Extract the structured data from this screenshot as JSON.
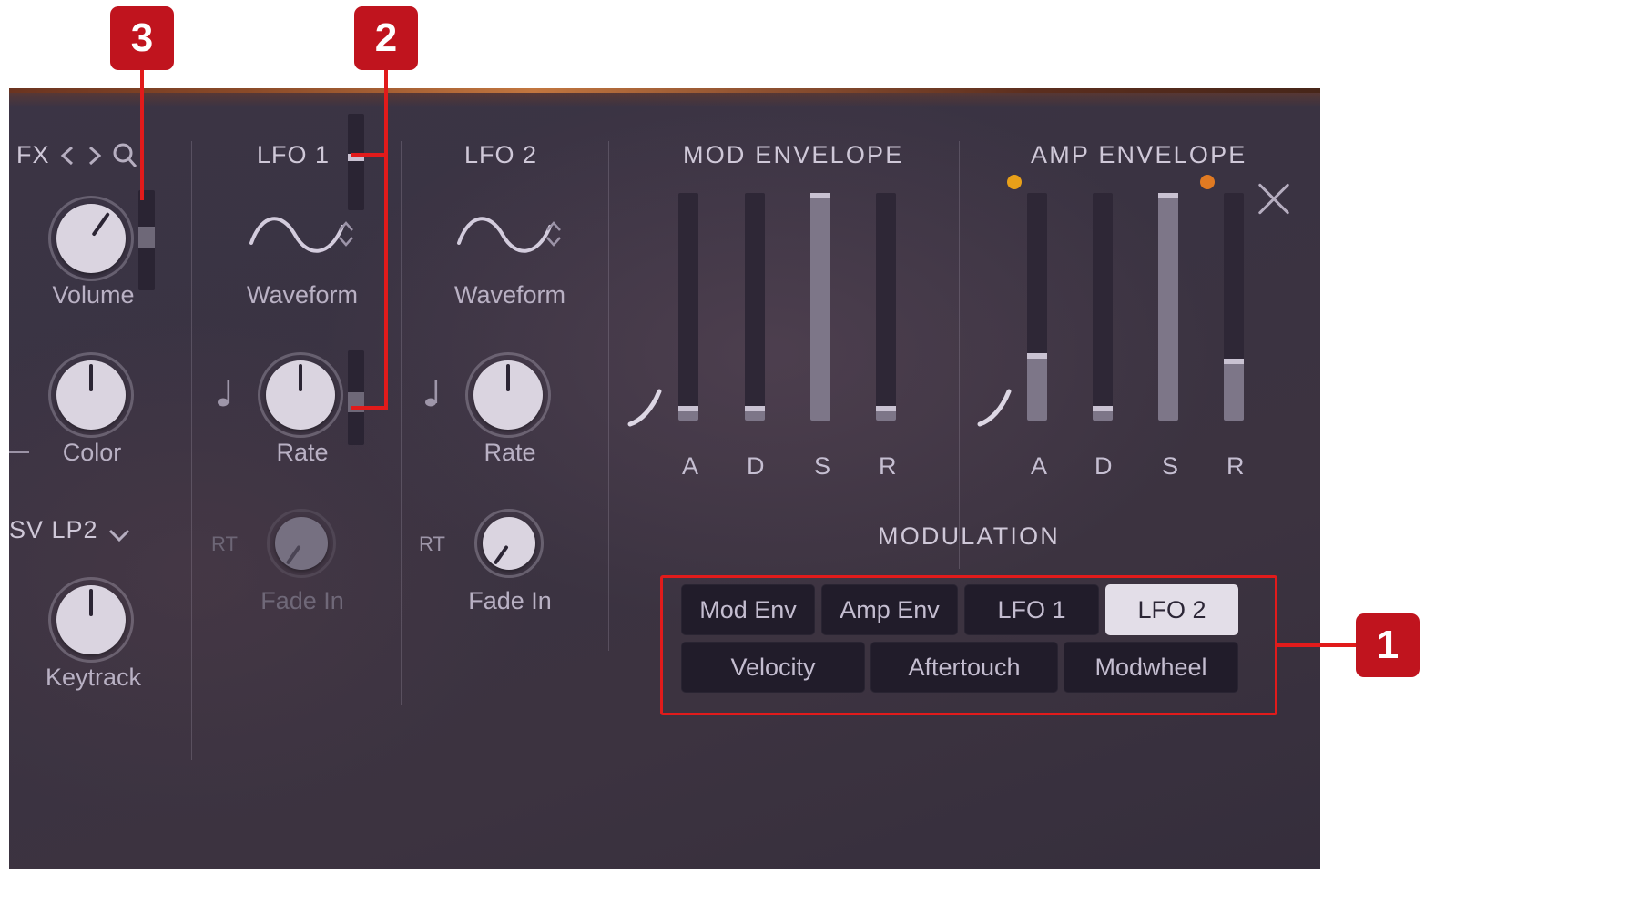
{
  "window": {
    "close_icon": "close-icon"
  },
  "left_panel": {
    "fx_label": "FX",
    "prev_icon": "chevron-left-icon",
    "next_icon": "chevron-right-icon",
    "search_icon": "search-icon",
    "volume_label": "Volume",
    "color_label": "Color",
    "filter_value": "SV LP2",
    "filter_chevron_icon": "chevron-down-icon",
    "keytrack_label": "Keytrack"
  },
  "lfo1": {
    "title": "LFO 1",
    "waveform_label": "Waveform",
    "waveform_icon": "sine-wave-icon",
    "waveform_stepper_icon": "stepper-updown-icon",
    "rate_label": "Rate",
    "rate_note_icon": "note-icon",
    "fade_in_label": "Fade In",
    "retrigger_label": "RT",
    "enabled": false
  },
  "lfo2": {
    "title": "LFO 2",
    "waveform_label": "Waveform",
    "waveform_icon": "sine-wave-icon",
    "waveform_stepper_icon": "stepper-updown-icon",
    "rate_label": "Rate",
    "rate_note_icon": "note-icon",
    "fade_in_label": "Fade In",
    "retrigger_label": "RT",
    "enabled": true
  },
  "mod_envelope": {
    "title": "MOD ENVELOPE",
    "curve_icon": "envelope-curve-icon",
    "stages": [
      {
        "label": "A",
        "value": 4
      },
      {
        "label": "D",
        "value": 4
      },
      {
        "label": "S",
        "value": 100
      },
      {
        "label": "R",
        "value": 4
      }
    ]
  },
  "amp_envelope": {
    "title": "AMP ENVELOPE",
    "curve_icon": "envelope-curve-icon",
    "dot_left_color": "#e8a019",
    "dot_right_color": "#e07a22",
    "stages": [
      {
        "label": "A",
        "value": 27
      },
      {
        "label": "D",
        "value": 4
      },
      {
        "label": "S",
        "value": 100
      },
      {
        "label": "R",
        "value": 25
      }
    ]
  },
  "modulation": {
    "title": "MODULATION",
    "row1": [
      {
        "label": "Mod Env",
        "active": false
      },
      {
        "label": "Amp Env",
        "active": false
      },
      {
        "label": "LFO 1",
        "active": false
      },
      {
        "label": "LFO 2",
        "active": true
      }
    ],
    "row2": [
      {
        "label": "Velocity",
        "active": false
      },
      {
        "label": "Aftertouch",
        "active": false
      },
      {
        "label": "Modwheel",
        "active": false
      }
    ]
  },
  "callouts": [
    {
      "number": "1"
    },
    {
      "number": "2"
    },
    {
      "number": "3"
    }
  ],
  "colors": {
    "accent_red": "#e11b1b",
    "badge_red": "#c0141e",
    "panel_bg": "#3a3342"
  }
}
